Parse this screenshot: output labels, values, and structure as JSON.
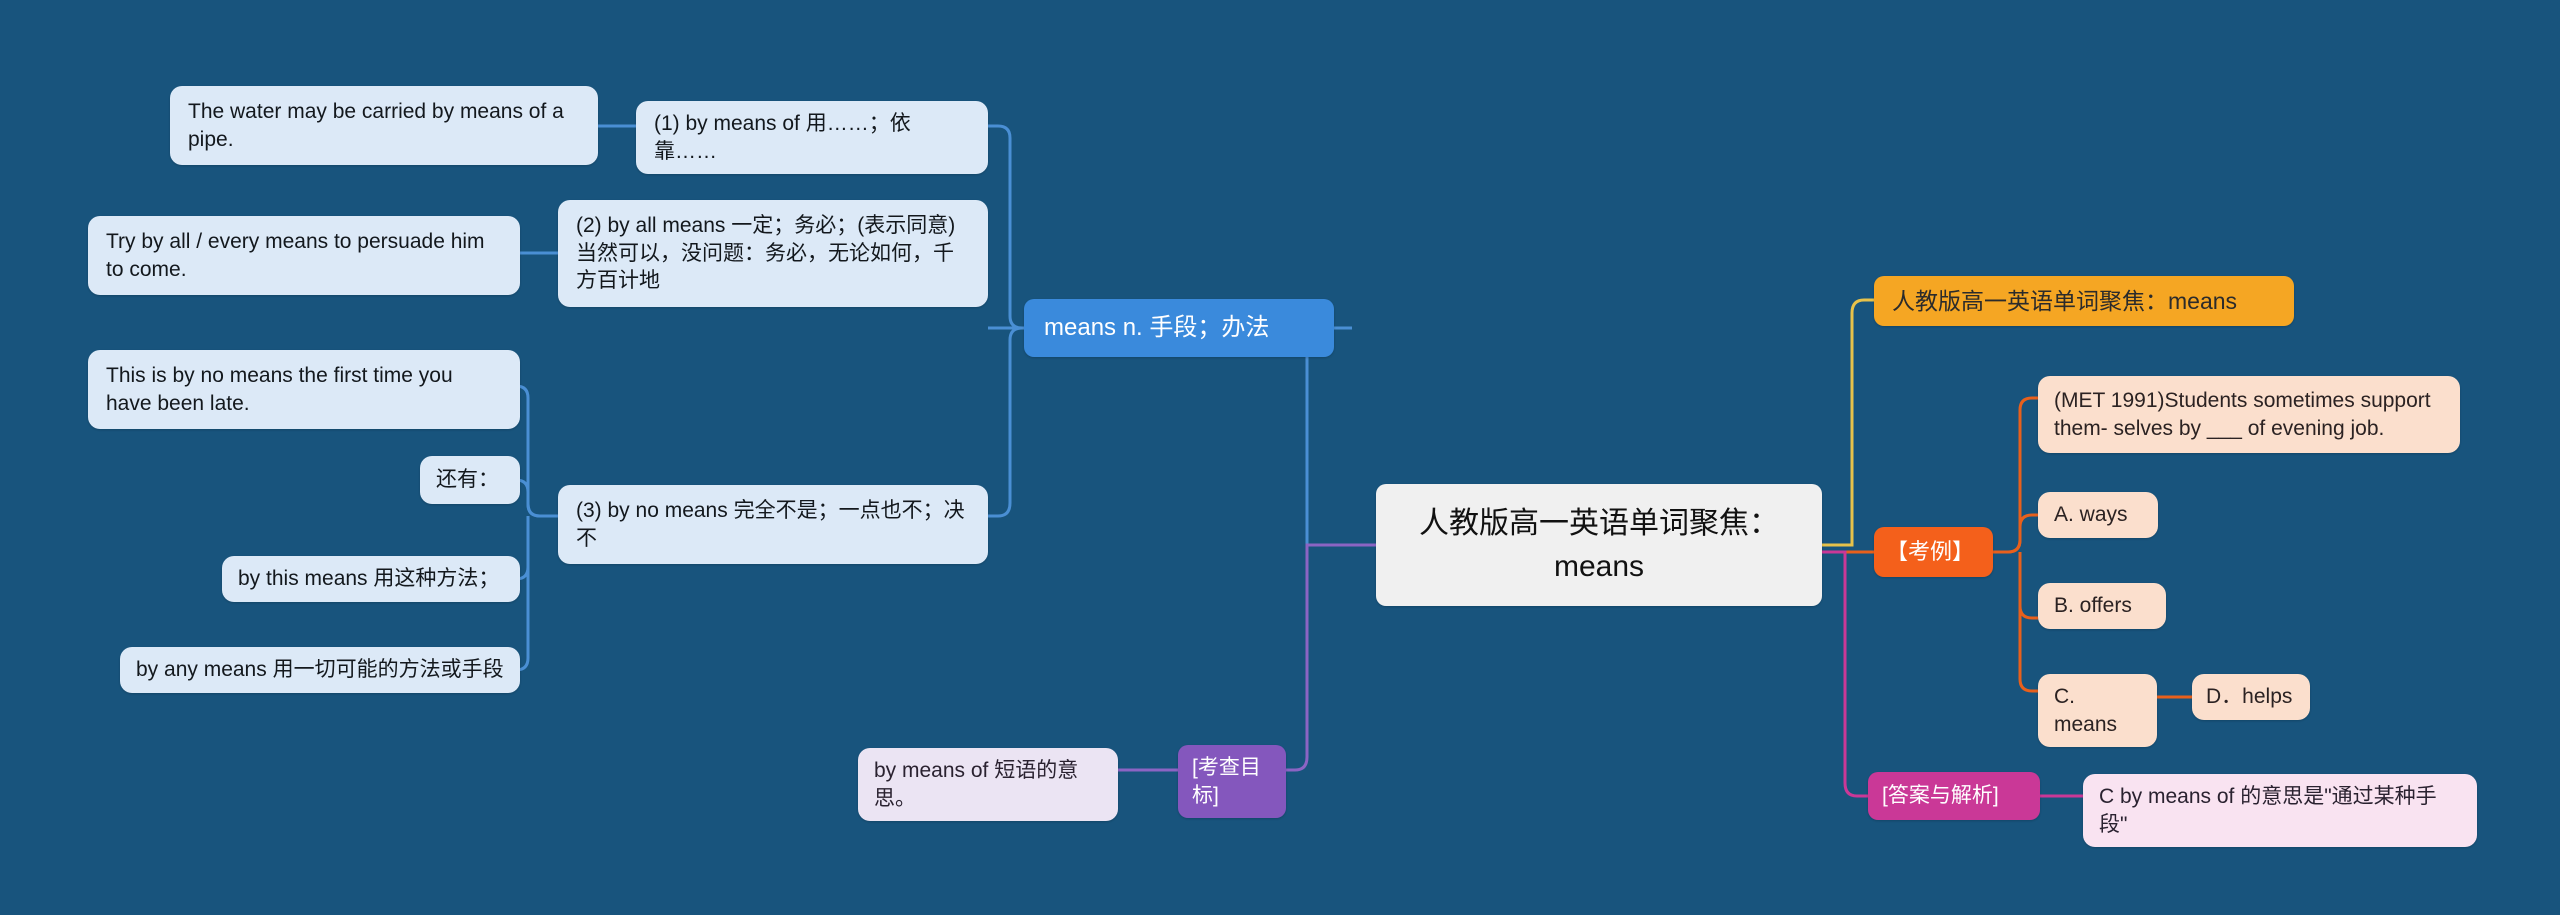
{
  "meta": {
    "background_color": "#18547d",
    "title": "人教版高一英语单词聚焦：means"
  },
  "central": {
    "label": "人教版高一英语单词聚焦：means",
    "color": "#f0f0f0"
  },
  "left_branch": {
    "main": {
      "label": "means n. 手段；办法",
      "color": "#3a8adc"
    },
    "definitions": [
      {
        "label": "(1) by means of 用……；依靠……"
      },
      {
        "label": "(2) by all means 一定；务必；(表示同意)当然可以，没问题：务必，无论如何，千方百计地"
      },
      {
        "label": "(3) by no means 完全不是；一点也不；决不"
      }
    ],
    "examples": [
      {
        "label": "The water may be carried by means of a pipe."
      },
      {
        "label": "Try by all / every means to persuade him to come."
      },
      {
        "label": "This is by no means the first time you have been late."
      }
    ],
    "extra_header": {
      "label": "还有："
    },
    "extra_items": [
      {
        "label": "by this means 用这种方法；"
      },
      {
        "label": "by any means 用一切可能的方法或手段"
      }
    ],
    "link_color": "#4a8fd4"
  },
  "bottom_branch": {
    "node": {
      "label": "[考查目标]",
      "color": "#8457bd"
    },
    "detail": {
      "label": "by means of 短语的意思。",
      "color": "#ebe4f3"
    },
    "link_color": "#8b64c4"
  },
  "right_branch": {
    "title_node": {
      "label": "人教版高一英语单词聚焦：means",
      "color": "#f5a623"
    },
    "title_link_color": "#e7c24a",
    "exam": {
      "node": {
        "label": "【考例】",
        "color": "#f4601b"
      },
      "question": {
        "label": "(MET 1991)Students sometimes support them- selves by ___ of evening job."
      },
      "options": [
        {
          "label": "A. ways"
        },
        {
          "label": "B. offers"
        },
        {
          "label": "C. means"
        },
        {
          "label": "D．helps"
        }
      ],
      "link_color": "#e8601c"
    },
    "answer": {
      "node": {
        "label": "[答案与解析]",
        "color": "#ca3897"
      },
      "detail": {
        "label": "C by means of 的意思是\"通过某种手段\""
      },
      "link_color": "#ca3897"
    }
  }
}
